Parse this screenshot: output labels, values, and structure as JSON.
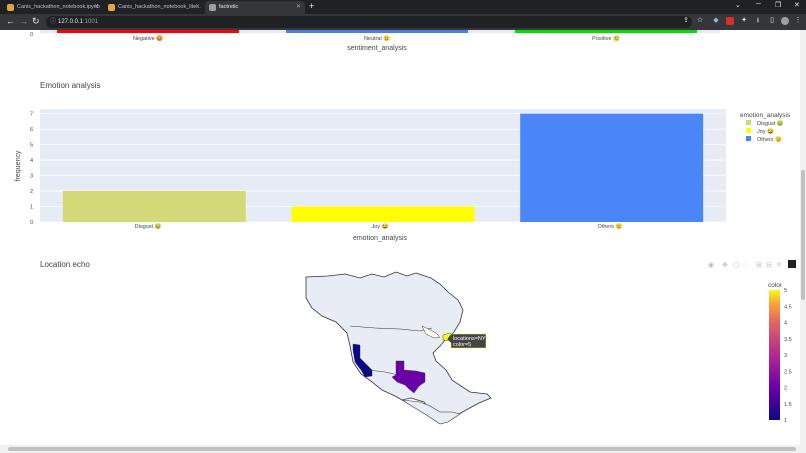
{
  "browser": {
    "tabs": [
      {
        "label": "Canis_hackathon_notebook.ipynb",
        "active": false,
        "fav_color": "#e8a33d"
      },
      {
        "label": "Canis_hackathon_notebook_lite...",
        "active": false,
        "fav_color": "#e8a33d"
      },
      {
        "label": "factretic",
        "active": true,
        "fav_color": "#9aa0a6"
      }
    ],
    "url_host": "127.0.0.1",
    "url_port": ":1001"
  },
  "sentiment": {
    "xlabel": "sentiment_analysis",
    "ticks": [
      "Negative 😡",
      "Neutral 😐",
      "Positive 😊"
    ],
    "y_zero": "0"
  },
  "emotion": {
    "title": "Emotion analysis",
    "ylabel": "frequency",
    "xlabel": "emotion_analysis",
    "legend_title": "emotion_analysis",
    "legend_items": [
      "Disgust 🤢",
      "Joy 😂",
      "Others 😐"
    ]
  },
  "location": {
    "title": "Location echo",
    "tooltip_line1": "locations=NY",
    "tooltip_line2": "color=5",
    "colorbar_title": "color",
    "colorbar_ticks": [
      "5",
      "4.5",
      "4",
      "3.5",
      "3",
      "2.5",
      "2",
      "1.5",
      "1"
    ]
  },
  "chart_data": [
    {
      "type": "bar",
      "title": "",
      "xlabel": "sentiment_analysis",
      "ylabel": "",
      "categories": [
        "Negative 😡",
        "Neutral 😐",
        "Positive 😊"
      ],
      "colors": [
        "#ff0000",
        "#4c7ee8",
        "#00e000"
      ]
    },
    {
      "type": "bar",
      "title": "Emotion analysis",
      "xlabel": "emotion_analysis",
      "ylabel": "frequency",
      "categories": [
        "Disgust 🤢",
        "Joy 😂",
        "Others 😐"
      ],
      "values": [
        2,
        1,
        7
      ],
      "colors": [
        "#d4d977",
        "#ffff00",
        "#4a86f7"
      ],
      "ylim": [
        0,
        7.3
      ],
      "yticks": [
        0,
        1,
        2,
        3,
        4,
        5,
        6,
        7
      ],
      "legend": "right",
      "grid": true
    },
    {
      "type": "choropleth",
      "title": "Location echo",
      "locations": [
        "CA",
        "TX",
        "NY"
      ],
      "values": [
        1,
        2,
        5
      ],
      "colorscale": "plasma",
      "range": [
        1,
        5
      ]
    }
  ]
}
